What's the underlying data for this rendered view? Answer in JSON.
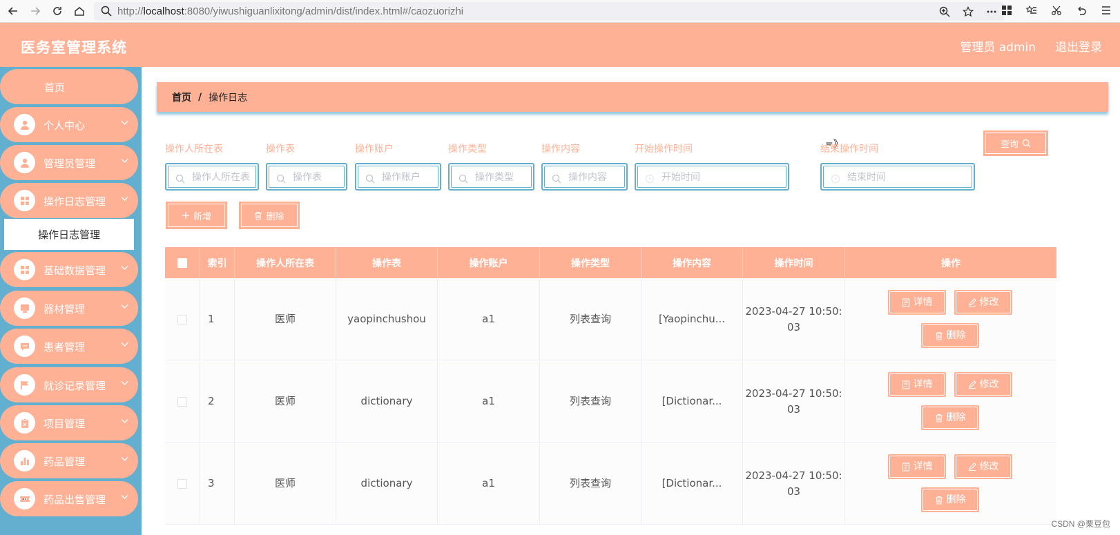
{
  "browser": {
    "url_prefix": "http://",
    "url_host": "localhost",
    "url_rest": ":8080/yiwushiguanlixitong/admin/dist/index.html#/caozuorizhi"
  },
  "header": {
    "title": "医务室管理系统",
    "user_label": "管理员 admin",
    "logout_label": "退出登录"
  },
  "sidebar": {
    "items": [
      {
        "label": "首页",
        "icon": "none"
      },
      {
        "label": "个人中心",
        "icon": "user-icon"
      },
      {
        "label": "管理员管理",
        "icon": "user-icon"
      },
      {
        "label": "操作日志管理",
        "icon": "grid-icon"
      },
      {
        "label": "基础数据管理",
        "icon": "grid-icon"
      },
      {
        "label": "器材管理",
        "icon": "monitor-icon"
      },
      {
        "label": "患者管理",
        "icon": "chat-icon"
      },
      {
        "label": "就诊记录管理",
        "icon": "flag-icon"
      },
      {
        "label": "项目管理",
        "icon": "clipboard-icon"
      },
      {
        "label": "药品管理",
        "icon": "bar-chart-icon"
      },
      {
        "label": "药品出售管理",
        "icon": "ticket-icon"
      }
    ],
    "active_submenu": "操作日志管理"
  },
  "breadcrumb": {
    "home": "首页",
    "separator": "/",
    "current": "操作日志"
  },
  "filters": {
    "fields": [
      {
        "label": "操作人所在表",
        "placeholder": "操作人所在表"
      },
      {
        "label": "操作表",
        "placeholder": "操作表"
      },
      {
        "label": "操作账户",
        "placeholder": "操作账户"
      },
      {
        "label": "操作类型",
        "placeholder": "操作类型"
      },
      {
        "label": "操作内容",
        "placeholder": "操作内容"
      },
      {
        "label": "开始操作时间",
        "placeholder": "开始时间"
      },
      {
        "label": "结束操作时间",
        "placeholder": "结束时间"
      }
    ],
    "range_separator": "=》",
    "query_label": "查询"
  },
  "actions": {
    "add_label": "新增",
    "delete_label": "删除"
  },
  "table": {
    "headers": [
      "索引",
      "操作人所在表",
      "操作表",
      "操作账户",
      "操作类型",
      "操作内容",
      "操作时间",
      "操作"
    ],
    "rows": [
      {
        "index": "1",
        "user_table": "医师",
        "op_table": "yaopinchushou",
        "account": "a1",
        "type": "列表查询",
        "content": "[Yaopinchu...",
        "time_a": "2023-04-27 10:50:",
        "time_b": "03"
      },
      {
        "index": "2",
        "user_table": "医师",
        "op_table": "dictionary",
        "account": "a1",
        "type": "列表查询",
        "content": "[Dictionar...",
        "time_a": "2023-04-27 10:50:",
        "time_b": "03"
      },
      {
        "index": "3",
        "user_table": "医师",
        "op_table": "dictionary",
        "account": "a1",
        "type": "列表查询",
        "content": "[Dictionar...",
        "time_a": "2023-04-27 10:50:",
        "time_b": "03"
      }
    ],
    "row_actions": {
      "detail": "详情",
      "edit": "修改",
      "delete": "删除"
    }
  },
  "watermark": "CSDN @栗豆包",
  "colors": {
    "accent": "#ffb196",
    "sidebar": "#63afcf"
  }
}
